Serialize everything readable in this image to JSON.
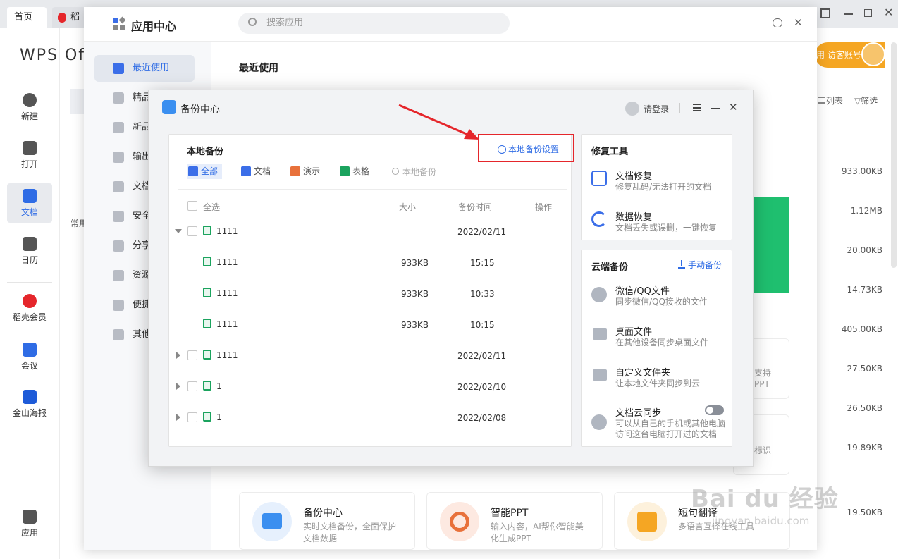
{
  "tabs": [
    {
      "label": "首页"
    },
    {
      "label": "稻"
    }
  ],
  "wps": {
    "logo_text": "WPS Of",
    "left_nav": [
      {
        "label": "新建"
      },
      {
        "label": "打开"
      },
      {
        "label": "文档"
      },
      {
        "label": "日历"
      },
      {
        "label": "稻壳会员"
      },
      {
        "label": "会议"
      },
      {
        "label": "金山海报"
      },
      {
        "label": "应用"
      }
    ],
    "section_label": "常用",
    "account_label": "用 访客账号",
    "view_list": "列表",
    "filter_label": "筛选",
    "file_sizes": [
      "933.00KB",
      "1.12MB",
      "20.00KB",
      "14.73KB",
      "405.00KB",
      "27.50KB",
      "26.50KB",
      "19.89KB",
      "19.50KB"
    ],
    "bg_partial_texts": [
      "支持",
      "PPT",
      "标识"
    ]
  },
  "app_center": {
    "title": "应用中心",
    "search_placeholder": "搜索应用",
    "sidebar": [
      {
        "label": "最近使用"
      },
      {
        "label": "精品"
      },
      {
        "label": "新品"
      },
      {
        "label": "输出"
      },
      {
        "label": "文档"
      },
      {
        "label": "安全"
      },
      {
        "label": "分享"
      },
      {
        "label": "资源"
      },
      {
        "label": "便捷"
      },
      {
        "label": "其他"
      }
    ],
    "recent_title": "最近使用",
    "bottom_apps": [
      {
        "title": "备份中心",
        "desc1": "实时文档备份，全面保护",
        "desc2": "文档数据"
      },
      {
        "title": "智能PPT",
        "desc1": "输入内容，AI帮你智能美",
        "desc2": "化生成PPT"
      },
      {
        "title": "短句翻译",
        "desc1": "多语言互译在线工具",
        "desc2": ""
      }
    ]
  },
  "backup": {
    "title": "备份中心",
    "login": "请登录",
    "local": {
      "title": "本地备份",
      "settings_link": "本地备份设置",
      "filters": [
        {
          "label": "全部",
          "color": "#3b6ee8"
        },
        {
          "label": "文档",
          "color": "#3b6ee8"
        },
        {
          "label": "演示",
          "color": "#e8713b"
        },
        {
          "label": "表格",
          "color": "#1ba35e"
        }
      ],
      "search_placeholder": "本地备份",
      "headers": {
        "select_all": "全选",
        "size": "大小",
        "time": "备份时间",
        "action": "操作"
      },
      "rows": [
        {
          "name": "1111",
          "size": "",
          "time": "2022/02/11",
          "level": 0,
          "expanded": true
        },
        {
          "name": "1111",
          "size": "933KB",
          "time": "15:15",
          "level": 1
        },
        {
          "name": "1111",
          "size": "933KB",
          "time": "10:33",
          "level": 1
        },
        {
          "name": "1111",
          "size": "933KB",
          "time": "10:15",
          "level": 1
        },
        {
          "name": "1111",
          "size": "",
          "time": "2022/02/11",
          "level": 0,
          "expanded": false
        },
        {
          "name": "1",
          "size": "",
          "time": "2022/02/10",
          "level": 0,
          "expanded": false
        },
        {
          "name": "1",
          "size": "",
          "time": "2022/02/08",
          "level": 0,
          "expanded": false
        }
      ]
    },
    "repair": {
      "title": "修复工具",
      "items": [
        {
          "title": "文档修复",
          "desc": "修复乱码/无法打开的文档",
          "icon": "doc-repair-icon"
        },
        {
          "title": "数据恢复",
          "desc": "文档丢失或误删，一键恢复",
          "icon": "data-recovery-icon"
        }
      ]
    },
    "cloud": {
      "title": "云端备份",
      "manual": "手动备份",
      "items": [
        {
          "title": "微信/QQ文件",
          "desc": "同步微信/QQ接收的文件",
          "icon": "chat-files-icon"
        },
        {
          "title": "桌面文件",
          "desc": "在其他设备同步桌面文件",
          "icon": "desktop-icon"
        },
        {
          "title": "自定义文件夹",
          "desc": "让本地文件夹同步到云",
          "icon": "folder-icon"
        },
        {
          "title": "文档云同步",
          "desc1": "可以从自己的手机或其他电脑",
          "desc2": "访问这台电脑打开过的文档",
          "icon": "cloud-upload-icon",
          "toggle": "off"
        }
      ]
    }
  },
  "watermark": {
    "brand": "Bai du 经验",
    "url": "jingyan.baidu.com"
  }
}
